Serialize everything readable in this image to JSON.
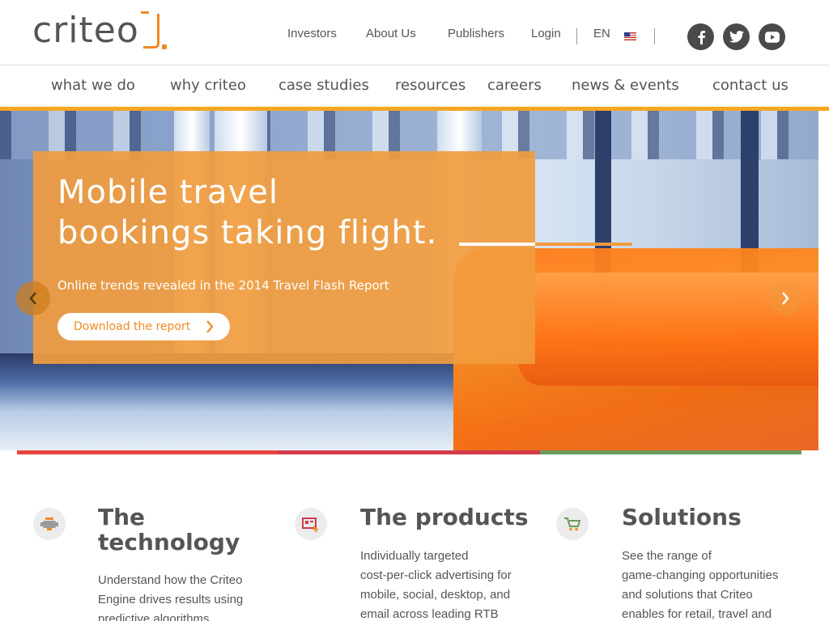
{
  "brand": {
    "logo_text": "criteo"
  },
  "top_links": {
    "investors": "Investors",
    "about": "About Us",
    "publishers": "Publishers",
    "login": "Login",
    "language": "EN"
  },
  "social": {
    "facebook_label": "f",
    "icons": [
      "facebook-icon",
      "twitter-icon",
      "youtube-icon"
    ]
  },
  "nav": {
    "what_we_do": "what we do",
    "why_criteo": "why criteo",
    "case_studies": "case studies",
    "resources": "resources",
    "careers": "careers",
    "news_events": "news & events",
    "contact_us": "contact us"
  },
  "hero": {
    "title": "Mobile travel\nbookings taking flight.",
    "subtitle": "Online trends revealed in the 2014 Travel Flash Report",
    "button": "Download the report"
  },
  "features": [
    {
      "title": "The\ntechnology",
      "text": "Understand how the Criteo\nEngine drives results using\npredictive algorithms"
    },
    {
      "title": "The products",
      "text": "Individually targeted\ncost-per-click advertising for\nmobile, social, desktop, and\nemail across leading RTB"
    },
    {
      "title": "Solutions",
      "text": "See the range of\ngame-changing opportunities\nand solutions that Criteo\nenables for retail, travel and"
    }
  ],
  "colors": {
    "brand_orange": "#f08a24",
    "nav_underline": "#f5a623",
    "hero_panel": "#f19c3e",
    "strip": [
      "#e8453c",
      "#d33a4a",
      "#6a9a5a"
    ]
  }
}
